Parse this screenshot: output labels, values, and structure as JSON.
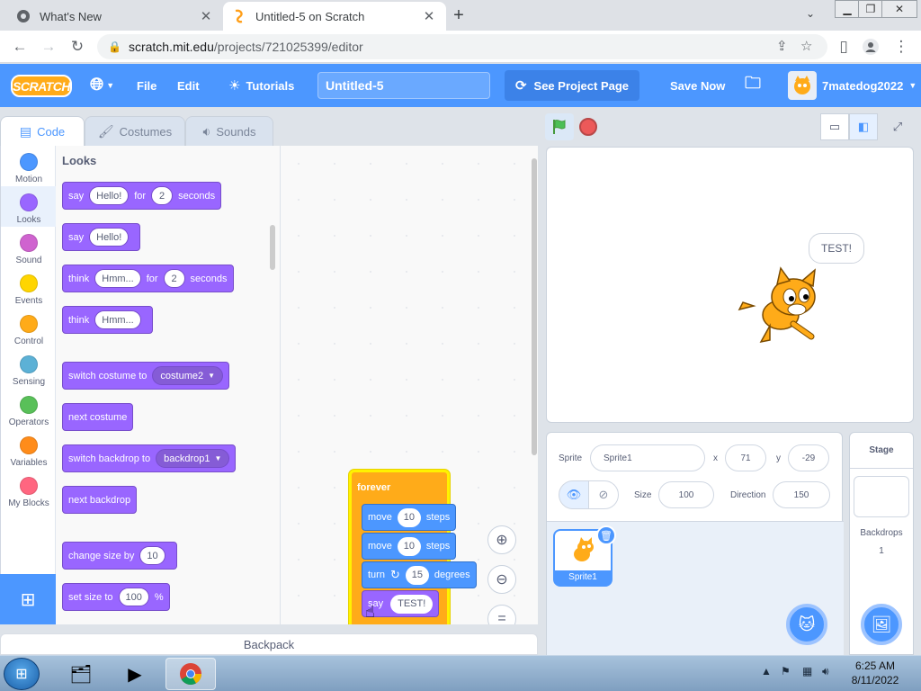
{
  "browser": {
    "tabs": [
      {
        "title": "What's New",
        "active": false
      },
      {
        "title": "Untitled-5 on Scratch",
        "active": true
      }
    ],
    "url_host": "scratch.mit.edu",
    "url_path": "/projects/721025399/editor"
  },
  "menubar": {
    "logo": "SCRATCH",
    "file": "File",
    "edit": "Edit",
    "tutorials": "Tutorials",
    "project_title": "Untitled-5",
    "see_project": "See Project Page",
    "save_now": "Save Now",
    "username": "7matedog2022",
    "color": "#4c97ff"
  },
  "editor_tabs": {
    "code": "Code",
    "costumes": "Costumes",
    "sounds": "Sounds"
  },
  "categories": [
    {
      "label": "Motion",
      "color": "#4c97ff"
    },
    {
      "label": "Looks",
      "color": "#9966ff"
    },
    {
      "label": "Sound",
      "color": "#cf63cf"
    },
    {
      "label": "Events",
      "color": "#ffd500"
    },
    {
      "label": "Control",
      "color": "#ffab19"
    },
    {
      "label": "Sensing",
      "color": "#5cb1d6"
    },
    {
      "label": "Operators",
      "color": "#59c059"
    },
    {
      "label": "Variables",
      "color": "#ff8c1a"
    },
    {
      "label": "My Blocks",
      "color": "#ff6680"
    }
  ],
  "palette": {
    "title": "Looks",
    "say_for": {
      "say": "say",
      "text": "Hello!",
      "for": "for",
      "secs": "2",
      "seconds": "seconds"
    },
    "say": {
      "say": "say",
      "text": "Hello!"
    },
    "think_for": {
      "think": "think",
      "text": "Hmm...",
      "for": "for",
      "secs": "2",
      "seconds": "seconds"
    },
    "think": {
      "think": "think",
      "text": "Hmm..."
    },
    "switch_costume": {
      "label": "switch costume to",
      "value": "costume2"
    },
    "next_costume": "next costume",
    "switch_backdrop": {
      "label": "switch backdrop to",
      "value": "backdrop1"
    },
    "next_backdrop": "next backdrop",
    "change_size": {
      "label": "change size by",
      "value": "10"
    },
    "set_size": {
      "label": "set size to",
      "value": "100",
      "unit": "%"
    }
  },
  "script": {
    "forever": "forever",
    "move1": {
      "move": "move",
      "value": "10",
      "steps": "steps"
    },
    "move2": {
      "move": "move",
      "value": "10",
      "steps": "steps"
    },
    "turn": {
      "turn": "turn",
      "value": "15",
      "degrees": "degrees"
    },
    "say": {
      "say": "say",
      "value": "TEST!"
    }
  },
  "backpack": "Backpack",
  "stage": {
    "bubble": "TEST!"
  },
  "sprite_info": {
    "sprite_label": "Sprite",
    "sprite_name": "Sprite1",
    "x_label": "x",
    "x": "71",
    "y_label": "y",
    "y": "-29",
    "size_label": "Size",
    "size": "100",
    "direction_label": "Direction",
    "direction": "150",
    "thumb_name": "Sprite1"
  },
  "stage_pane": {
    "title": "Stage",
    "backdrops_label": "Backdrops",
    "backdrops_count": "1"
  },
  "taskbar": {
    "time": "6:25 AM",
    "date": "8/11/2022"
  }
}
